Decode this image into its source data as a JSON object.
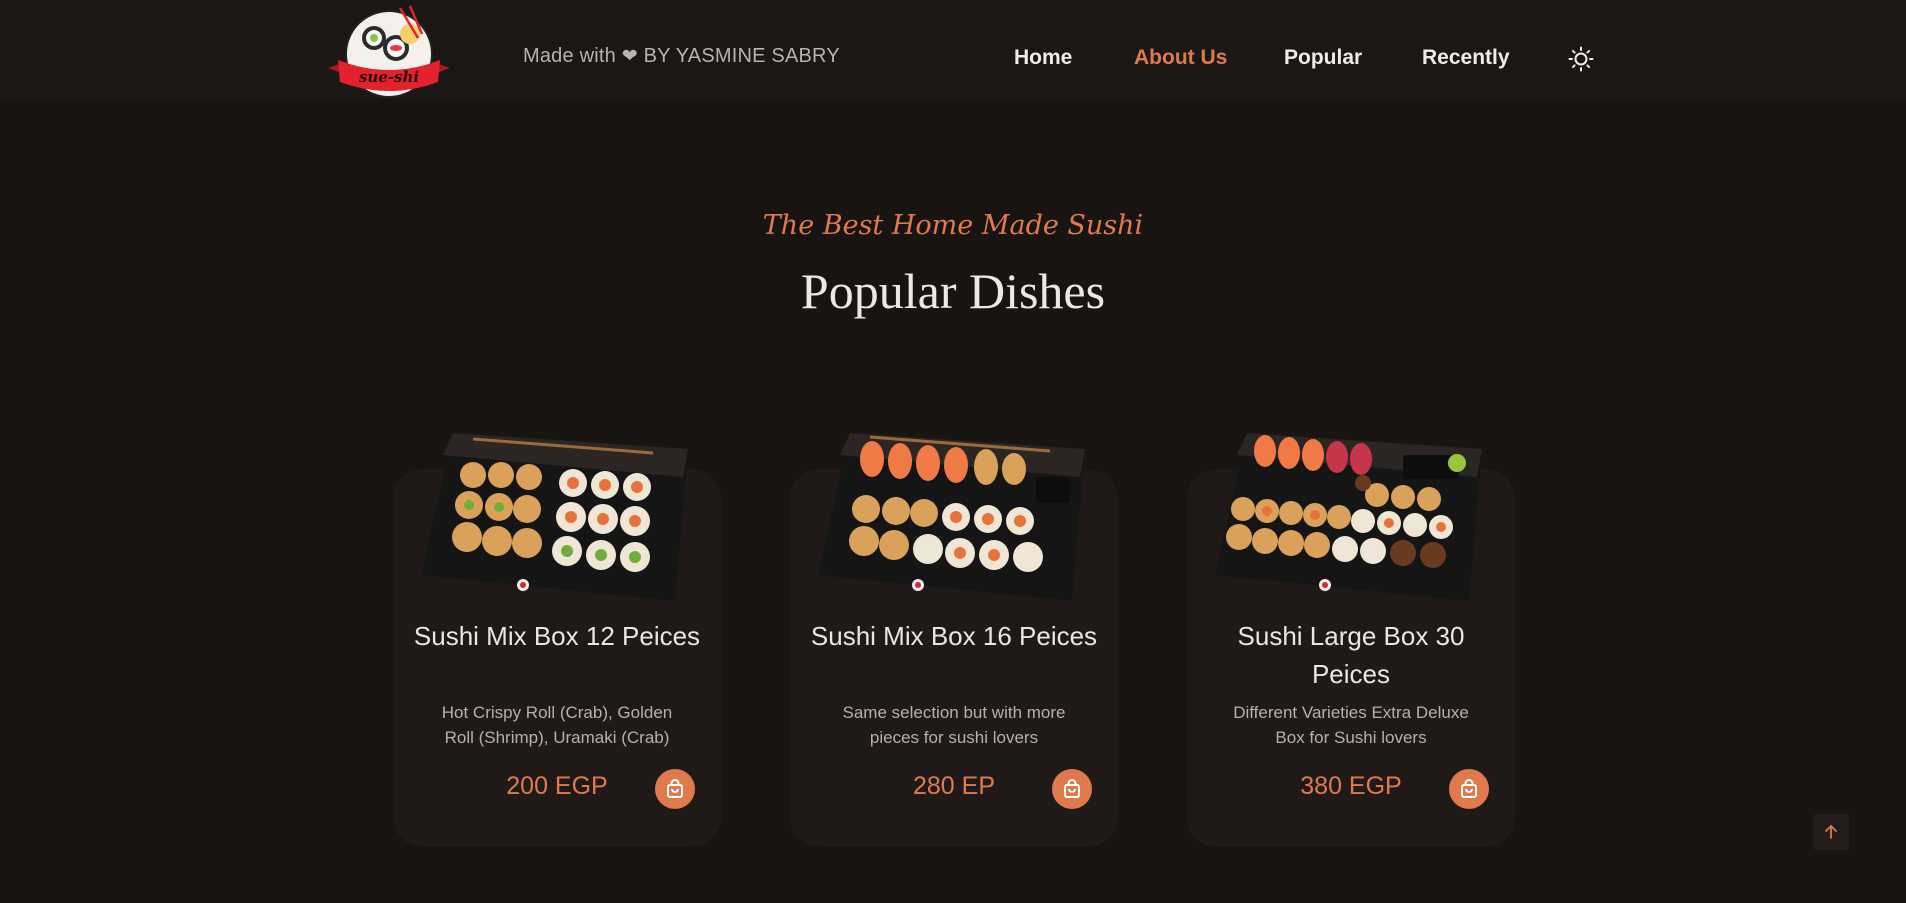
{
  "header": {
    "logo_text": "sue-shi",
    "tagline_prefix": "Made with",
    "tagline_suffix": "BY YASMINE SABRY",
    "heart_icon": "heart-icon",
    "nav": [
      {
        "label": "Home",
        "active": false
      },
      {
        "label": "About Us",
        "active": true
      },
      {
        "label": "Popular",
        "active": false
      },
      {
        "label": "Recently",
        "active": false
      }
    ],
    "theme_icon": "sun-icon"
  },
  "section": {
    "subtitle": "The Best Home Made Sushi",
    "title": "Popular Dishes"
  },
  "dishes": [
    {
      "name": "Sushi Mix Box 12 Peices",
      "description": "Hot Crispy Roll (Crab), Golden Roll (Shrimp), Uramaki (Crab)",
      "price": "200 EGP",
      "cart_icon": "shopping-bag-icon"
    },
    {
      "name": "Sushi Mix Box 16 Peices",
      "description": "Same selection but with more pieces for sushi lovers",
      "price": "280 EP",
      "cart_icon": "shopping-bag-icon"
    },
    {
      "name": "Sushi Large Box 30 Peices",
      "description": "Different Varieties Extra Deluxe Box for Sushi lovers",
      "price": "380 EGP",
      "cart_icon": "shopping-bag-icon"
    }
  ],
  "colors": {
    "background": "#181411",
    "card": "#1f1a17",
    "accent": "#e07a4d",
    "text": "#ece6e2"
  },
  "scroll_top_icon": "arrow-up-icon"
}
